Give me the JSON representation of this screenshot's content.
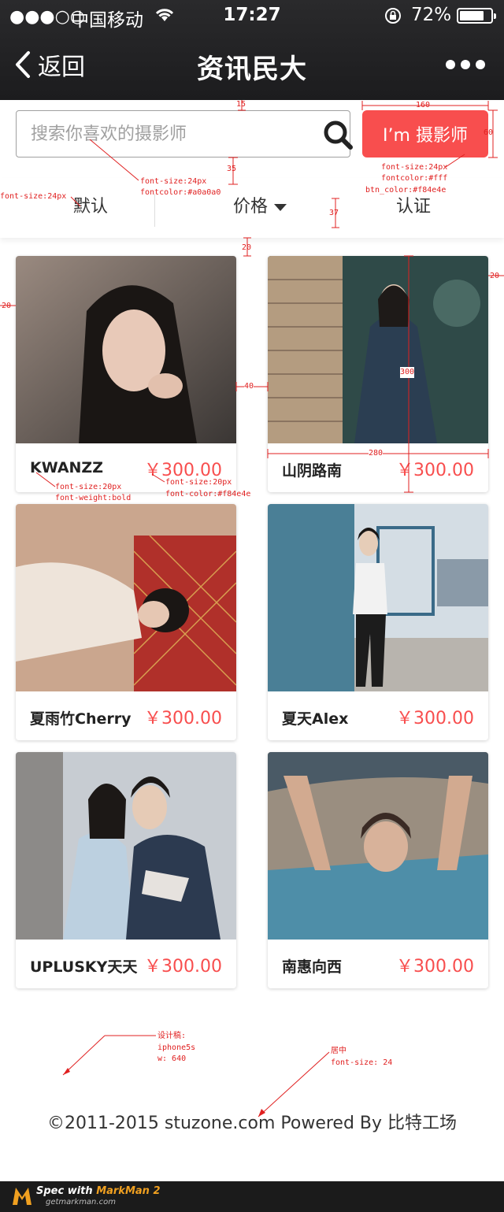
{
  "status_bar": {
    "signal": "●●●○○",
    "carrier": "中国移动",
    "time": "17:27",
    "battery_pct": "72%"
  },
  "nav": {
    "back_label": "返回",
    "title": "资讯民大"
  },
  "search": {
    "placeholder": "搜索你喜欢的摄影师"
  },
  "cta_label": "I’m 摄影师",
  "tabs": [
    {
      "label": "默认"
    },
    {
      "label": "价格"
    },
    {
      "label": "认证"
    }
  ],
  "cards": [
    {
      "name": "KWANZZ",
      "price": "￥300.00"
    },
    {
      "name": "山阴路南",
      "price": "￥300.00"
    },
    {
      "name": "夏雨竹Cherry",
      "price": "￥300.00"
    },
    {
      "name": "夏天Alex",
      "price": "￥300.00"
    },
    {
      "name": "UPLUSKY天天",
      "price": "￥300.00"
    },
    {
      "name": "南惠向西",
      "price": "￥300.00"
    }
  ],
  "annotations": {
    "m15": "15",
    "m160": "160",
    "m60": "60",
    "m35": "35",
    "m37": "37",
    "m20a": "20",
    "m20b": "20",
    "m20c": "20",
    "m40": "40",
    "m300": "300",
    "m280": "280",
    "search_font": "font-size:24px",
    "search_color": "fontcolor:#a0a0a0",
    "tab_font": "font-size:24px",
    "btn_font": "font-size:24px",
    "btn_fcolor": "fontcolor:#fff",
    "btn_color": "btn_color:#f84e4e",
    "name_font": "font-size:20px",
    "name_weight": "font-weight:bold",
    "price_font": "font-size:20px",
    "price_color": "font-color:#f84e4e",
    "design1": "设计稿:",
    "design2": "iphone5s",
    "design3": "w: 640",
    "center1": "居中",
    "center2": "font-size: 24"
  },
  "footer": "©2011-2015 stuzone.com Powered By 比特工场",
  "markman": {
    "line1_a": "Spec with ",
    "line1_b": "MarkMan 2",
    "line2": "getmarkman.com"
  },
  "colors": {
    "accent": "#f84e4e",
    "placeholder": "#a0a0a0",
    "annotation": "#e02020"
  }
}
